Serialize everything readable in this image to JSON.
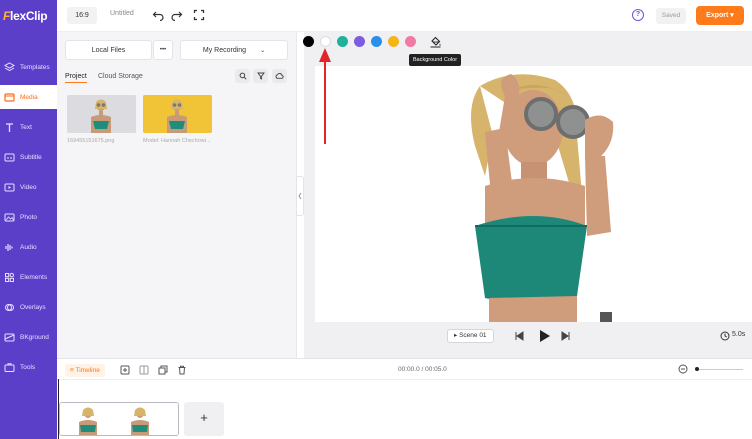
{
  "app": {
    "logo_f": "F",
    "logo_rest": "lexClip"
  },
  "colors": {
    "nav_bg": "#5b3fc9",
    "accent": "#ff7a1a",
    "help": "#6a55e0"
  },
  "nav": [
    {
      "label": "Templates",
      "icon": "templates-icon"
    },
    {
      "label": "Media",
      "icon": "media-icon",
      "active": true
    },
    {
      "label": "Text",
      "icon": "text-icon"
    },
    {
      "label": "Subtitle",
      "icon": "subtitle-icon"
    },
    {
      "label": "Video",
      "icon": "video-icon"
    },
    {
      "label": "Photo",
      "icon": "photo-icon"
    },
    {
      "label": "Audio",
      "icon": "audio-icon"
    },
    {
      "label": "Elements",
      "icon": "elements-icon"
    },
    {
      "label": "Overlays",
      "icon": "overlays-icon"
    },
    {
      "label": "BKground",
      "icon": "background-icon"
    },
    {
      "label": "Tools",
      "icon": "tools-icon"
    }
  ],
  "topbar": {
    "ratio": "16:9",
    "title": "Untitled",
    "help": "?",
    "saved": "Saved",
    "export": "Export"
  },
  "media": {
    "local_files": "Local Files",
    "more": "•••",
    "recording": "My Recording",
    "tabs": [
      "Project",
      "Cloud Storage"
    ],
    "items": [
      {
        "caption": "169455151675.png"
      },
      {
        "caption": "Model: Hannah Chechowi..."
      }
    ]
  },
  "canvas": {
    "swatches": [
      "#000000",
      "#ffffff",
      "#1fb29a",
      "#7c5ce0",
      "#2b8fe8",
      "#f5b51a",
      "#f07aa5"
    ],
    "tooltip": "Background Color",
    "scene": "Scene 01",
    "duration": "5.0s"
  },
  "timeline": {
    "label": "Timeline",
    "time": "00:00.0 / 00:05.0",
    "add": "+"
  }
}
